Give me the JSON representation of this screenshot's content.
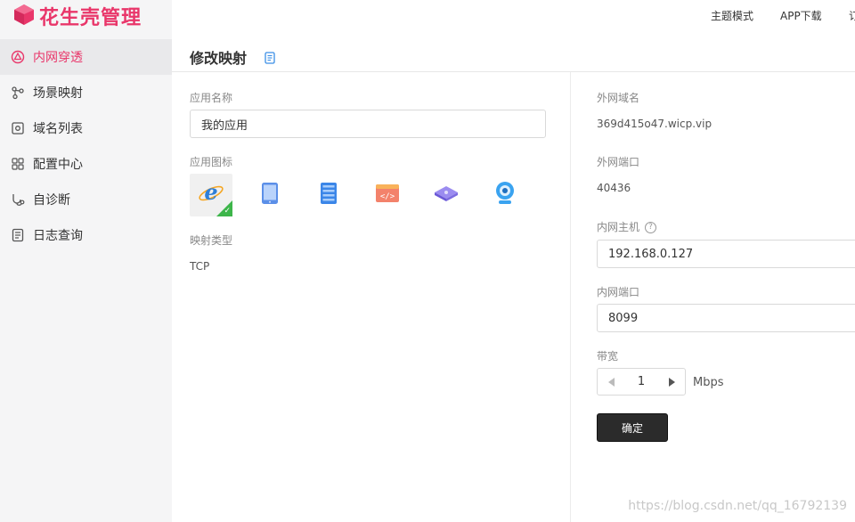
{
  "app": {
    "logo_text": "花生壳管理"
  },
  "sidebar": {
    "items": [
      {
        "label": "内网穿透",
        "icon": "network-icon",
        "active": true
      },
      {
        "label": "场景映射",
        "icon": "scene-icon",
        "active": false
      },
      {
        "label": "域名列表",
        "icon": "domain-icon",
        "active": false
      },
      {
        "label": "配置中心",
        "icon": "grid-icon",
        "active": false
      },
      {
        "label": "自诊断",
        "icon": "diagnose-icon",
        "active": false
      },
      {
        "label": "日志查询",
        "icon": "log-icon",
        "active": false
      }
    ]
  },
  "topbar": {
    "theme_mode": "主题模式",
    "app_download": "APP下载",
    "cut_off": "订"
  },
  "page": {
    "title": "修改映射"
  },
  "form": {
    "app_name_label": "应用名称",
    "app_name_value": "我的应用",
    "app_icon_label": "应用图标",
    "icons": [
      "ie-icon",
      "tablet-icon",
      "server-icon",
      "code-icon",
      "router-icon",
      "camera-icon"
    ],
    "mapping_type_label": "映射类型",
    "mapping_type_value": "TCP"
  },
  "right": {
    "ext_domain_label": "外网域名",
    "ext_domain_value": "369d415o47.wicp.vip",
    "ext_port_label": "外网端口",
    "ext_port_value": "40436",
    "int_host_label": "内网主机",
    "int_host_value": "192.168.0.127",
    "int_port_label": "内网端口",
    "int_port_value": "8099",
    "bandwidth_label": "带宽",
    "bandwidth_value": "1",
    "bandwidth_unit": "Mbps",
    "confirm_label": "确定"
  },
  "watermark": "https://blog.csdn.net/qq_16792139",
  "colors": {
    "brand": "#e9366a",
    "success": "#3db54a",
    "dark_button": "#2b2b2b"
  }
}
